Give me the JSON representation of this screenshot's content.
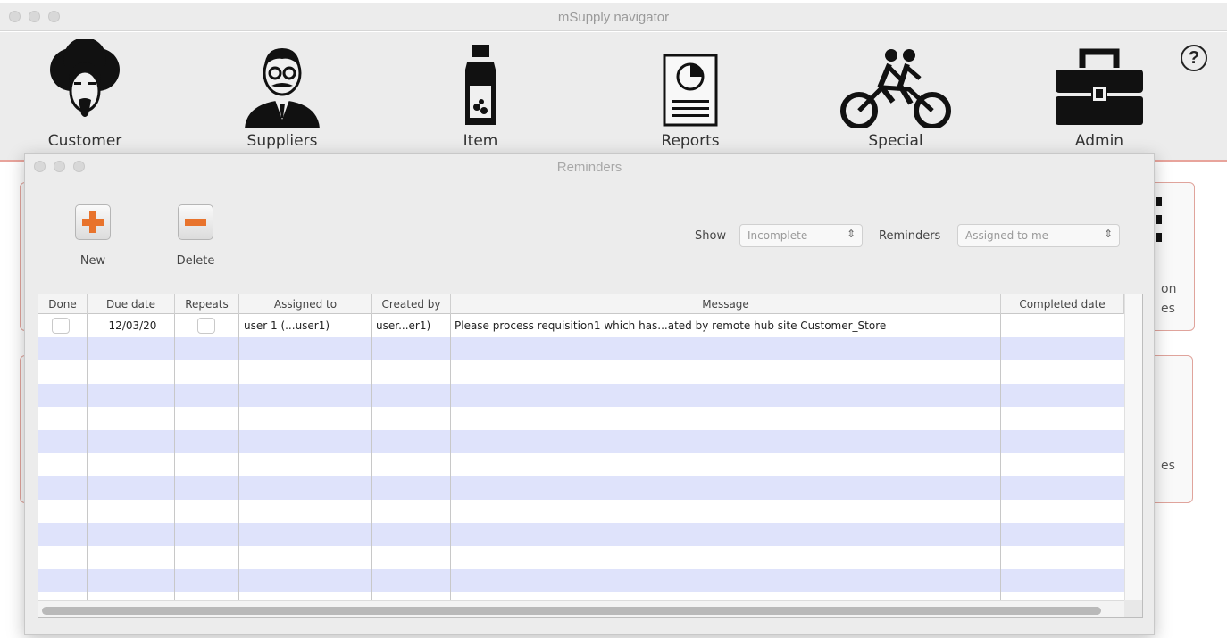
{
  "navigator": {
    "title": "mSupply navigator",
    "buttons": [
      {
        "label": "Customer",
        "icon": "customer-icon"
      },
      {
        "label": "Suppliers",
        "icon": "suppliers-icon"
      },
      {
        "label": "Item",
        "icon": "item-icon"
      },
      {
        "label": "Reports",
        "icon": "reports-icon"
      },
      {
        "label": "Special",
        "icon": "special-icon"
      },
      {
        "label": "Admin",
        "icon": "admin-icon"
      }
    ],
    "help_label": "?",
    "background_fragments": [
      "on",
      "es",
      "es"
    ]
  },
  "reminders": {
    "title": "Reminders",
    "toolbar": {
      "new_label": "New",
      "delete_label": "Delete",
      "show_label": "Show",
      "show_value": "Incomplete",
      "reminders_label": "Reminders",
      "reminders_value": "Assigned to me"
    },
    "columns": [
      "Done",
      "Due date",
      "Repeats",
      "Assigned to",
      "Created by",
      "Message",
      "Completed date"
    ],
    "rows": [
      {
        "done": false,
        "due_date": "12/03/20",
        "repeats": false,
        "assigned_to": "user 1 (...user1)",
        "created_by": "user...er1)",
        "message": "Please process requisition1 which has...ated by remote hub site Customer_Store",
        "completed_date": ""
      }
    ]
  },
  "colors": {
    "accent_border": "#e0a49c",
    "row_stripe": "#dfe3fb",
    "new_icon": "#e8732c",
    "delete_icon": "#e8732c"
  }
}
